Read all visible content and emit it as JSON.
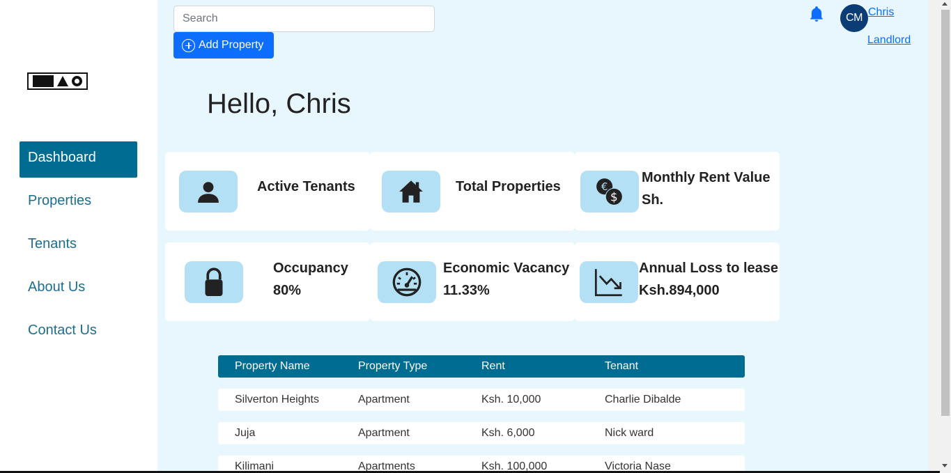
{
  "header": {
    "search_placeholder": "Search",
    "add_property_label": "Add Property",
    "avatar_initials": "CM",
    "user_name": "Chris",
    "user_role": "Landlord"
  },
  "sidebar": {
    "items": [
      {
        "label": "Dashboard",
        "active": true
      },
      {
        "label": "Properties",
        "active": false
      },
      {
        "label": "Tenants",
        "active": false
      },
      {
        "label": "About Us",
        "active": false
      },
      {
        "label": "Contact Us",
        "active": false
      }
    ]
  },
  "greeting": "Hello, Chris",
  "cards": [
    {
      "title": "Active Tenants",
      "value": "",
      "icon": "person-icon"
    },
    {
      "title": "Total Properties",
      "value": "",
      "icon": "house-icon"
    },
    {
      "title": "Monthly Rent Value",
      "value": "Sh.",
      "icon": "currency-exchange-icon"
    },
    {
      "title": "Occupancy",
      "value": "80%",
      "icon": "lock-icon"
    },
    {
      "title": "Economic Vacancy",
      "value": "11.33%",
      "icon": "speedometer-icon"
    },
    {
      "title": "Annual Loss to lease",
      "value": "Ksh.894,000",
      "icon": "graph-down-icon"
    }
  ],
  "table": {
    "headers": [
      "Property Name",
      "Property Type",
      "Rent",
      "Tenant"
    ],
    "rows": [
      [
        "Silverton Heights",
        "Apartment",
        "Ksh. 10,000",
        "Charlie Dibalde"
      ],
      [
        "Juja",
        "Apartment",
        "Ksh. 6,000",
        "Nick ward"
      ],
      [
        "Kilimani",
        "Apartments",
        "Ksh. 100,000",
        "Victoria Nase"
      ]
    ]
  },
  "colors": {
    "primary": "#0d6efd",
    "nav_active": "#006c91",
    "main_bg": "#e8f7fd",
    "icon_bg": "#b3e0f5",
    "avatar_bg": "#0b3c75"
  }
}
